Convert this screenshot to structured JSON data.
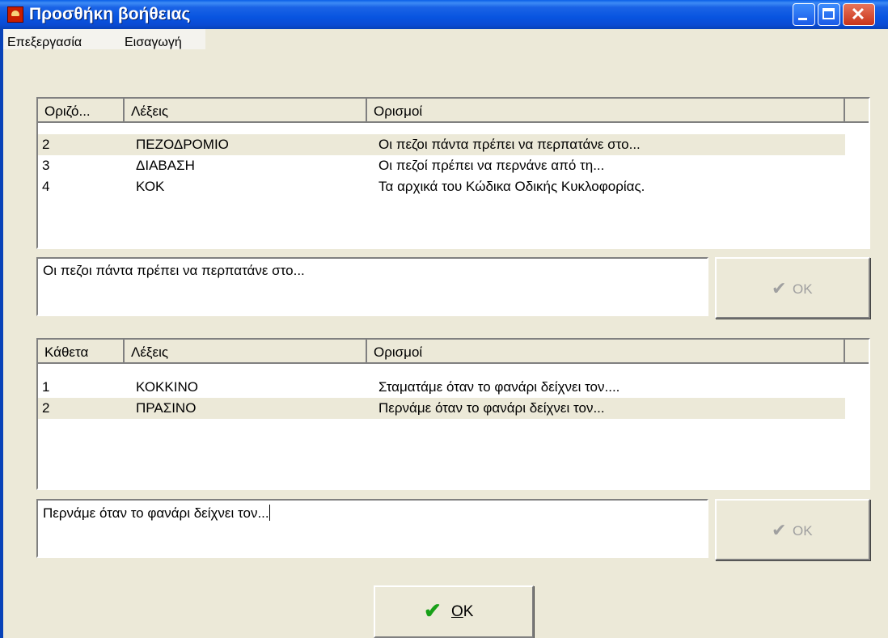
{
  "window": {
    "title": "Προσθήκη βοήθειας",
    "controls": {
      "minimize": "_",
      "maximize": "□",
      "close": "✕"
    }
  },
  "menu": [
    "Επεξεργασία",
    "Εισαγωγή"
  ],
  "across": {
    "columns": [
      "Οριζό...",
      "Λέξεις",
      "Ορισμοί"
    ],
    "rows": [
      {
        "num": "2",
        "word": "ΠΕΖΟΔΡΟΜΙΟ",
        "definition": "Οι πεζοι πάντα πρέπει να περπατάνε στο...",
        "selected": true
      },
      {
        "num": "3",
        "word": "ΔΙΑΒΑΣΗ",
        "definition": "Οι πεζοί πρέπει να περνάνε από τη...",
        "selected": false
      },
      {
        "num": "4",
        "word": "ΚΟΚ",
        "definition": "Τα αρχικά του Κώδικα Οδικής Κυκλοφορίας.",
        "selected": false
      }
    ],
    "edit_value": "Οι πεζοι πάντα πρέπει να περπατάνε στο...",
    "ok_label": "OK"
  },
  "down": {
    "columns": [
      "Κάθετα",
      "Λέξεις",
      "Ορισμοί"
    ],
    "rows": [
      {
        "num": "1",
        "word": "ΚΟΚΚΙΝΟ",
        "definition": "Σταματάμε όταν το φανάρι δείχνει τον....",
        "selected": false
      },
      {
        "num": "2",
        "word": "ΠΡΑΣΙΝΟ",
        "definition": "Περνάμε όταν  το φανάρι δείχνει τον...",
        "selected": true
      }
    ],
    "edit_value": "Περνάμε όταν  το φανάρι δείχνει τον...",
    "ok_label": "OK"
  },
  "main_ok": {
    "label_underlined": "O",
    "label_rest": "K"
  },
  "icons": {
    "check_disabled": "✔",
    "check": "✔"
  },
  "colors": {
    "title_bar": "#0a4bd4",
    "face": "#ece9d8",
    "ok_check": "#18a018"
  }
}
